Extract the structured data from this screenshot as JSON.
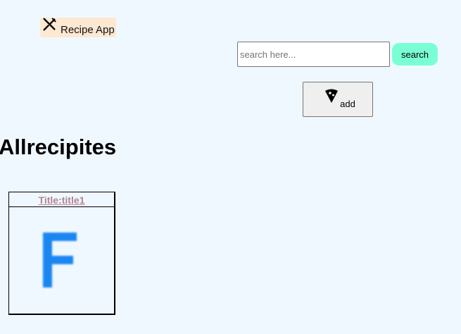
{
  "header": {
    "app_title": "Recipe App",
    "icon": "fork-knife-icon"
  },
  "search": {
    "placeholder": "search here...",
    "value": "",
    "button_label": "search"
  },
  "add_button": {
    "label": "add",
    "icon": "pizza-slice-icon"
  },
  "main": {
    "heading": "Allrecipites",
    "recipes": [
      {
        "title": "Title:title1",
        "image_letter": "F",
        "image_color": "#1a86f2"
      }
    ]
  },
  "colors": {
    "page_background": "#f0f8ff",
    "app_badge_background": "#fde8d2",
    "search_button": "#7affd4",
    "card_title": "#b08590"
  }
}
